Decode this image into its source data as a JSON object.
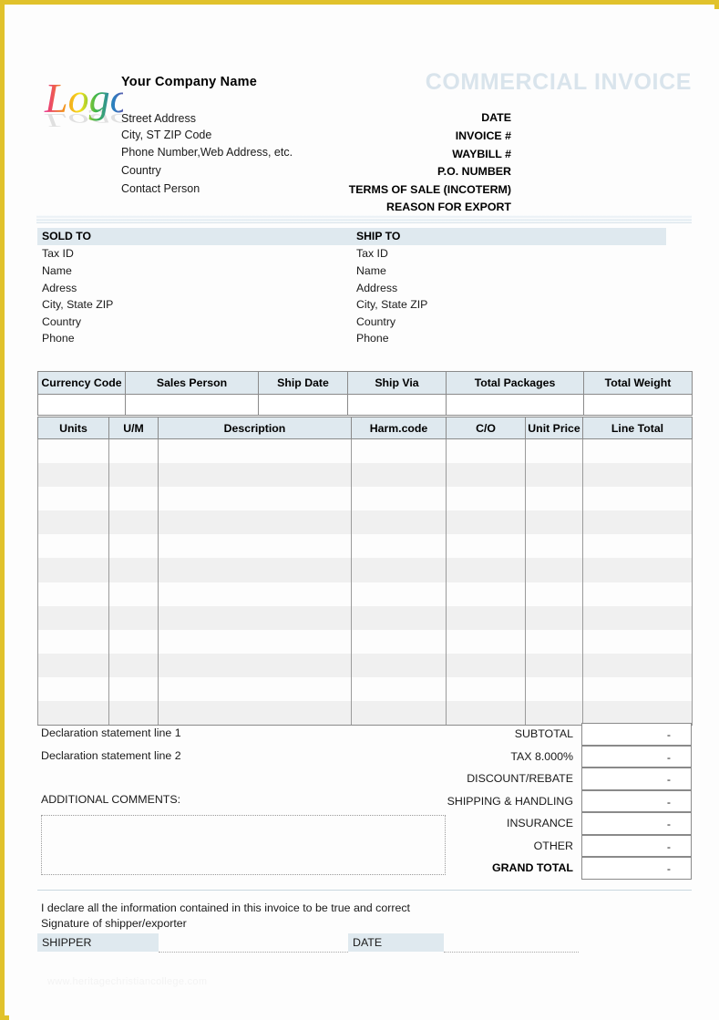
{
  "page": {
    "border_color": "#e1c22c",
    "background": "#fdfdfd",
    "accent_color": "#dfe9ef",
    "title_color": "#d9e4ec"
  },
  "header": {
    "logo_alt": "Logo",
    "company_name": "Your Company Name",
    "company_lines": [
      "Street Address",
      "City, ST  ZIP Code",
      "Phone Number,Web Address, etc.",
      "Country",
      "Contact Person"
    ],
    "document_title": "COMMERCIAL INVOICE",
    "meta_labels": [
      "DATE",
      "INVOICE #",
      "WAYBILL #",
      "P.O. NUMBER",
      "TERMS OF SALE (INCOTERM)",
      "REASON FOR EXPORT"
    ]
  },
  "sold_to": {
    "heading": "SOLD  TO",
    "lines": [
      "Tax ID",
      "Name",
      "Adress",
      "City, State ZIP",
      "Country",
      "Phone"
    ]
  },
  "ship_to": {
    "heading": "SHIP TO",
    "lines": [
      "Tax ID",
      "Name",
      "Address",
      "City, State ZIP",
      "Country",
      "Phone"
    ]
  },
  "shipping_details": {
    "headers": [
      "Currency Code",
      "Sales Person",
      "Ship Date",
      "Ship Via",
      "Total Packages",
      "Total Weight"
    ],
    "values": [
      "",
      "",
      "",
      "",
      "",
      ""
    ]
  },
  "line_items": {
    "headers": [
      "Units",
      "U/M",
      "Description",
      "Harm.code",
      "C/O",
      "Unit Price",
      "Line Total"
    ],
    "row_count": 12,
    "rows": []
  },
  "declaration": {
    "line1": "Declaration statement line 1",
    "line2": "Declaration statement line 2",
    "comments_label": "ADDITIONAL COMMENTS:",
    "comments_value": ""
  },
  "totals": {
    "rows": [
      {
        "label": "SUBTOTAL",
        "value": "-",
        "bold": false
      },
      {
        "label": "TAX    8.000%",
        "value": "-",
        "bold": false
      },
      {
        "label": "DISCOUNT/REBATE",
        "value": "-",
        "bold": false
      },
      {
        "label": "SHIPPING & HANDLING",
        "value": "-",
        "bold": false
      },
      {
        "label": "INSURANCE",
        "value": "-",
        "bold": false
      },
      {
        "label": "OTHER",
        "value": "-",
        "bold": false
      },
      {
        "label": "GRAND TOTAL",
        "value": "-",
        "bold": true
      }
    ],
    "tax_rate": "8.000%"
  },
  "footer": {
    "declare_text": "I declare all the information contained in this invoice to be true and correct",
    "signature_text": "Signature of shipper/exporter",
    "shipper_label": "SHIPPER",
    "shipper_value": "",
    "date_label": "DATE",
    "date_value": "",
    "watermark": "www.heritagechristiancollege.com"
  }
}
